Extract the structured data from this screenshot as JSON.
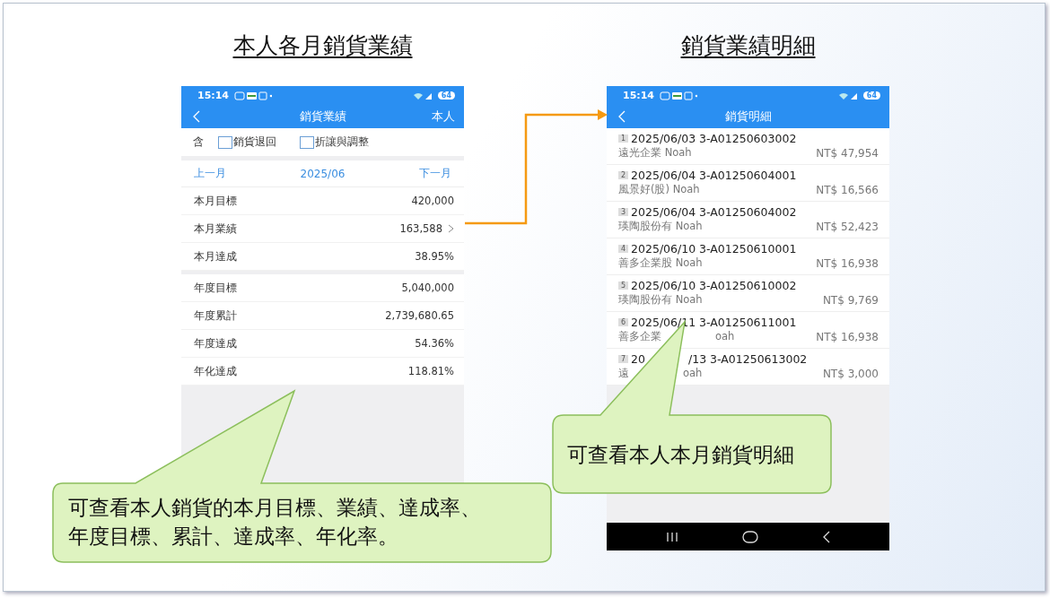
{
  "slide_titles": [
    "本人各月銷貨業績",
    "銷貨業績明細"
  ],
  "summary_screen": {
    "status_bar": {
      "time": "15:14",
      "battery": "64"
    },
    "header": {
      "title": "銷貨業績",
      "action": "本人"
    },
    "filter": {
      "label": "含",
      "options": [
        {
          "label": "銷貨退回",
          "checked": false
        },
        {
          "label": "折讓與調整",
          "checked": false
        }
      ]
    },
    "month_nav": {
      "prev": "上一月",
      "month": "2025/06",
      "next": "下一月"
    },
    "groups": [
      [
        {
          "label": "本月目標",
          "value": "420,000",
          "link": false
        },
        {
          "label": "本月業績",
          "value": "163,588",
          "link": true
        },
        {
          "label": "本月達成",
          "value": "38.95%",
          "link": false
        }
      ],
      [
        {
          "label": "年度目標",
          "value": "5,040,000",
          "link": false
        },
        {
          "label": "年度累計",
          "value": "2,739,680.65",
          "link": false
        },
        {
          "label": "年度達成",
          "value": "54.36%",
          "link": false
        },
        {
          "label": "年化達成",
          "value": "118.81%",
          "link": false
        }
      ]
    ]
  },
  "detail_screen": {
    "status_bar": {
      "time": "15:14",
      "battery": "64"
    },
    "header": {
      "title": "銷貨明細"
    },
    "rows": [
      {
        "index": "1",
        "line": "2025/06/03 3-A01250603002",
        "customer": "遠光企業 Noah",
        "amount": "NT$ 47,954"
      },
      {
        "index": "2",
        "line": "2025/06/04 3-A01250604001",
        "customer": "風景好(股) Noah",
        "amount": "NT$ 16,566"
      },
      {
        "index": "3",
        "line": "2025/06/04 3-A01250604002",
        "customer": "瑛陶股份有 Noah",
        "amount": "NT$ 52,423"
      },
      {
        "index": "4",
        "line": "2025/06/10 3-A01250610001",
        "customer": "善多企業股 Noah",
        "amount": "NT$ 16,938"
      },
      {
        "index": "5",
        "line": "2025/06/10 3-A01250610002",
        "customer": "瑛陶股份有 Noah",
        "amount": "NT$ 9,769"
      },
      {
        "index": "6",
        "line": "2025/06/11 3-A01250611001",
        "customer": [
          "善多企業",
          "oah"
        ],
        "amount": "NT$ 16,938"
      },
      {
        "index": "7",
        "line": [
          "20",
          "/13 3-A01250613002"
        ],
        "customer": [
          "遠",
          "oah"
        ],
        "amount": "NT$ 3,000"
      }
    ]
  },
  "callouts": [
    {
      "lines": [
        "可查看本人銷貨的本月目標、業績、達成率、",
        "年度目標、累計、達成率、年化率。"
      ]
    },
    {
      "lines": [
        "可查看本人本月銷貨明細"
      ]
    }
  ]
}
